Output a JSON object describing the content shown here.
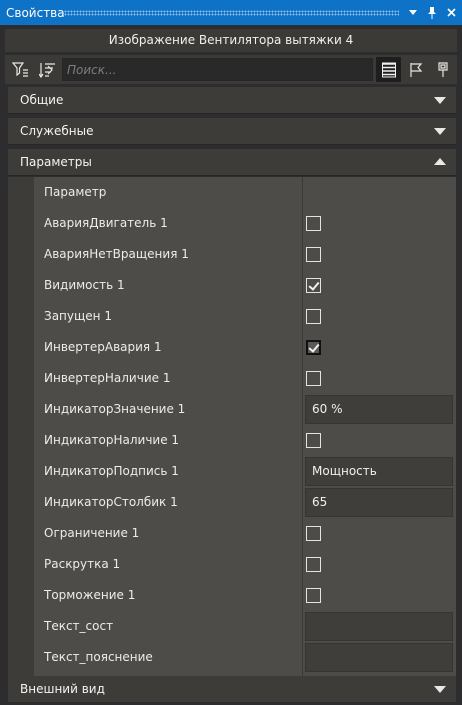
{
  "window": {
    "title": "Свойства",
    "accent": "#0e72c7"
  },
  "header": {
    "title": "Изображение Вентилятора вытяжки 4"
  },
  "toolbar": {
    "search_placeholder": "Поиск...",
    "icons": [
      "filter-icon",
      "sort-icon",
      "list-view-icon",
      "flag-icon",
      "pin-icon"
    ]
  },
  "sections": [
    {
      "label": "Общие",
      "expanded": false
    },
    {
      "label": "Служебные",
      "expanded": false
    },
    {
      "label": "Параметры",
      "expanded": true
    },
    {
      "label": "Внешний вид",
      "expanded": false
    }
  ],
  "params": {
    "header_label": "Параметр",
    "rows": [
      {
        "name": "АварияДвигатель 1",
        "type": "checkbox",
        "checked": false
      },
      {
        "name": "АварияНетВращения 1",
        "type": "checkbox",
        "checked": false
      },
      {
        "name": "Видимость 1",
        "type": "checkbox",
        "checked": true
      },
      {
        "name": "Запущен 1",
        "type": "checkbox",
        "checked": false
      },
      {
        "name": "ИнвертерАвария 1",
        "type": "checkbox",
        "checked": true
      },
      {
        "name": "ИнвертерНаличие 1",
        "type": "checkbox",
        "checked": false
      },
      {
        "name": "ИндикаторЗначение 1",
        "type": "text",
        "value": "60 %"
      },
      {
        "name": "ИндикаторНаличие 1",
        "type": "checkbox",
        "checked": false
      },
      {
        "name": "ИндикаторПодпись 1",
        "type": "text",
        "value": "Мощность"
      },
      {
        "name": "ИндикаторСтолбик 1",
        "type": "text",
        "value": "65"
      },
      {
        "name": "Ограничение 1",
        "type": "checkbox",
        "checked": false
      },
      {
        "name": "Раскрутка 1",
        "type": "checkbox",
        "checked": false
      },
      {
        "name": "Торможение 1",
        "type": "checkbox",
        "checked": false
      },
      {
        "name": "Текст_сост",
        "type": "text",
        "value": ""
      },
      {
        "name": "Текст_пояснение",
        "type": "text",
        "value": ""
      }
    ]
  }
}
